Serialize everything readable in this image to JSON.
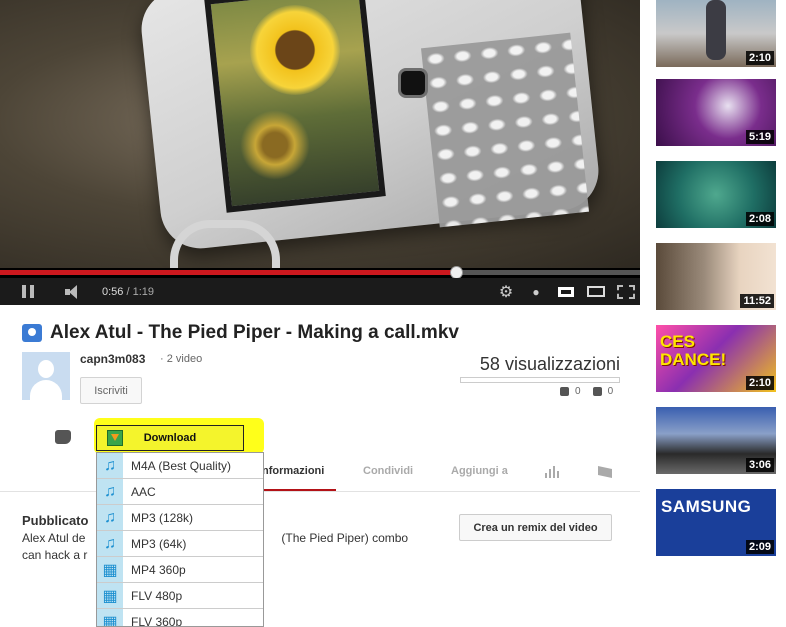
{
  "player": {
    "current_time": "0:56",
    "duration": "/ 1:19",
    "progress": 0.712
  },
  "video": {
    "title": "Alex Atul - The Pied Piper - Making a call.mkv"
  },
  "channel": {
    "name": "capn3m083",
    "video_count": "· 2 video",
    "subscribe_label": "Iscriviti"
  },
  "stats": {
    "views": "58 visualizzazioni",
    "likes": "0",
    "dislikes": "0"
  },
  "download": {
    "label": "Download",
    "options": [
      {
        "label": "M4A (Best Quality)",
        "icon": "music-note-icon"
      },
      {
        "label": "AAC",
        "icon": "music-note-icon"
      },
      {
        "label": "MP3 (128k)",
        "icon": "music-note-icon"
      },
      {
        "label": "MP3 (64k)",
        "icon": "music-note-icon"
      },
      {
        "label": "MP4 360p",
        "icon": "film-icon"
      },
      {
        "label": "FLV 480p",
        "icon": "film-icon"
      },
      {
        "label": "FLV 360p",
        "icon": "film-icon"
      }
    ]
  },
  "tabs": {
    "info": "nformazioni",
    "share": "Condividi",
    "add_to": "Aggiungi a"
  },
  "description": {
    "published_label": "Pubblicato",
    "line1_start": "Alex Atul de",
    "line1_end": "(The Pied Piper) combo",
    "line2_start": "can hack a r"
  },
  "remix_label": "Crea un remix del video",
  "sidebar": {
    "videos": [
      {
        "duration": "2:10"
      },
      {
        "duration": "5:19"
      },
      {
        "duration": "2:08"
      },
      {
        "duration": "11:52"
      },
      {
        "duration": "2:10",
        "overlay_text": "CES DANCE!"
      },
      {
        "duration": "3:06"
      },
      {
        "duration": "2:09",
        "overlay_text": "SAMSUNG"
      }
    ]
  },
  "colors": {
    "progress_red": "#cc181e",
    "download_yellow": "#ffff1a",
    "dropdown_icon_bg": "#bfe3f2"
  }
}
